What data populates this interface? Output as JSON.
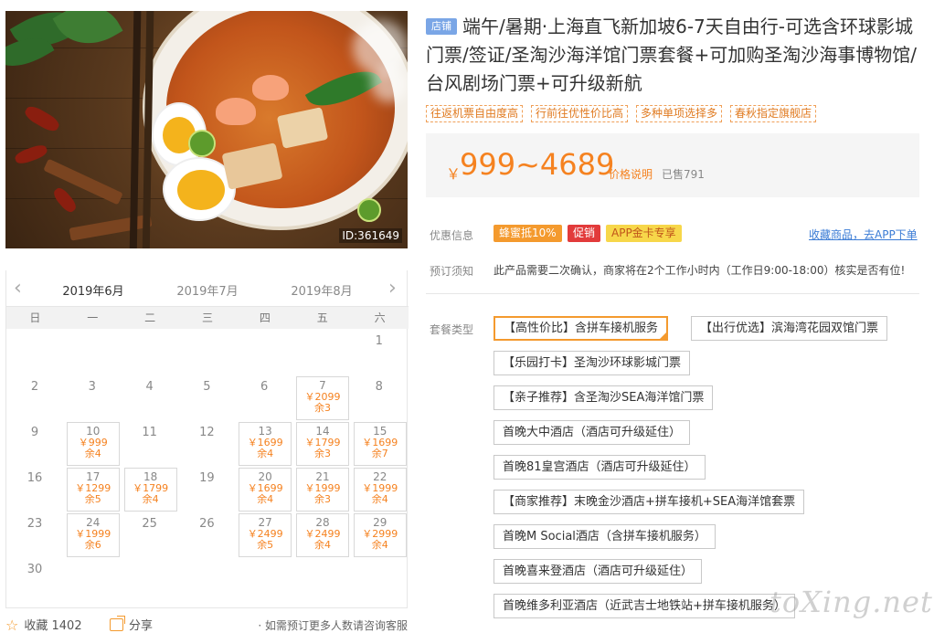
{
  "hero": {
    "id_tag": "ID:361649"
  },
  "calendar": {
    "months": [
      "2019年6月",
      "2019年7月",
      "2019年8月"
    ],
    "weekdays": [
      "日",
      "一",
      "二",
      "三",
      "四",
      "五",
      "六"
    ],
    "days": [
      {
        "d": "1"
      },
      {
        "d": "2"
      },
      {
        "d": "3"
      },
      {
        "d": "4"
      },
      {
        "d": "5"
      },
      {
        "d": "6"
      },
      {
        "d": "7",
        "price": "￥2099",
        "stock": "余3"
      },
      {
        "d": "8"
      },
      {
        "d": "9"
      },
      {
        "d": "10",
        "price": "￥999",
        "stock": "余4"
      },
      {
        "d": "11"
      },
      {
        "d": "12"
      },
      {
        "d": "13",
        "price": "￥1699",
        "stock": "余4"
      },
      {
        "d": "14",
        "price": "￥1799",
        "stock": "余3"
      },
      {
        "d": "15",
        "price": "￥1699",
        "stock": "余7"
      },
      {
        "d": "16"
      },
      {
        "d": "17",
        "price": "￥1299",
        "stock": "余5"
      },
      {
        "d": "18",
        "price": "￥1799",
        "stock": "余4"
      },
      {
        "d": "19"
      },
      {
        "d": "20",
        "price": "￥1699",
        "stock": "余4"
      },
      {
        "d": "21",
        "price": "￥1999",
        "stock": "余3"
      },
      {
        "d": "22",
        "price": "￥1999",
        "stock": "余4"
      },
      {
        "d": "23"
      },
      {
        "d": "24",
        "price": "￥1999",
        "stock": "余6"
      },
      {
        "d": "25"
      },
      {
        "d": "26"
      },
      {
        "d": "27",
        "price": "￥2499",
        "stock": "余5"
      },
      {
        "d": "28",
        "price": "￥2499",
        "stock": "余4"
      },
      {
        "d": "29",
        "price": "￥2999",
        "stock": "余4"
      },
      {
        "d": "30"
      }
    ]
  },
  "footer": {
    "fav_label": "收藏",
    "fav_count": "1402",
    "share_label": "分享",
    "note": "· 如需预订更多人数请咨询客服"
  },
  "product": {
    "store_badge": "店铺",
    "title": "端午/暑期·上海直飞新加坡6-7天自由行-可选含环球影城门票/签证/圣淘沙海洋馆门票套餐+可加购圣淘沙海事博物馆/台风剧场门票+可升级新航",
    "tags": [
      "往返机票自由度高",
      "行前往优性价比高",
      "多种单项选择多",
      "春秋指定旗舰店"
    ],
    "currency": "￥",
    "price": "999~4689",
    "price_link": "价格说明",
    "sold": "已售791"
  },
  "promo": {
    "label": "优惠信息",
    "badges": [
      "蜂蜜抵10%",
      "促销",
      "APP金卡专享"
    ],
    "app_link": "收藏商品，去APP下单"
  },
  "booking": {
    "label": "预订须知",
    "text": "此产品需要二次确认，商家将在2个工作小时内（工作日9:00-18:00）核实是否有位!"
  },
  "packages": {
    "label": "套餐类型",
    "items": [
      "【高性价比】含拼车接机服务",
      "【出行优选】滨海湾花园双馆门票",
      "【乐园打卡】圣淘沙环球影城门票",
      "【亲子推荐】含圣淘沙SEA海洋馆门票",
      "首晚大中酒店（酒店可升级延住）",
      "首晚81皇宫酒店（酒店可升级延住）",
      "【商家推荐】末晚金沙酒店+拼车接机+SEA海洋馆套票",
      "首晚M Social酒店（含拼车接机服务）",
      "首晚喜来登酒店（酒店可升级延住）",
      "首晚维多利亚酒店（近武吉士地铁站+拼车接机服务）"
    ]
  },
  "watermark": "toXing.net"
}
